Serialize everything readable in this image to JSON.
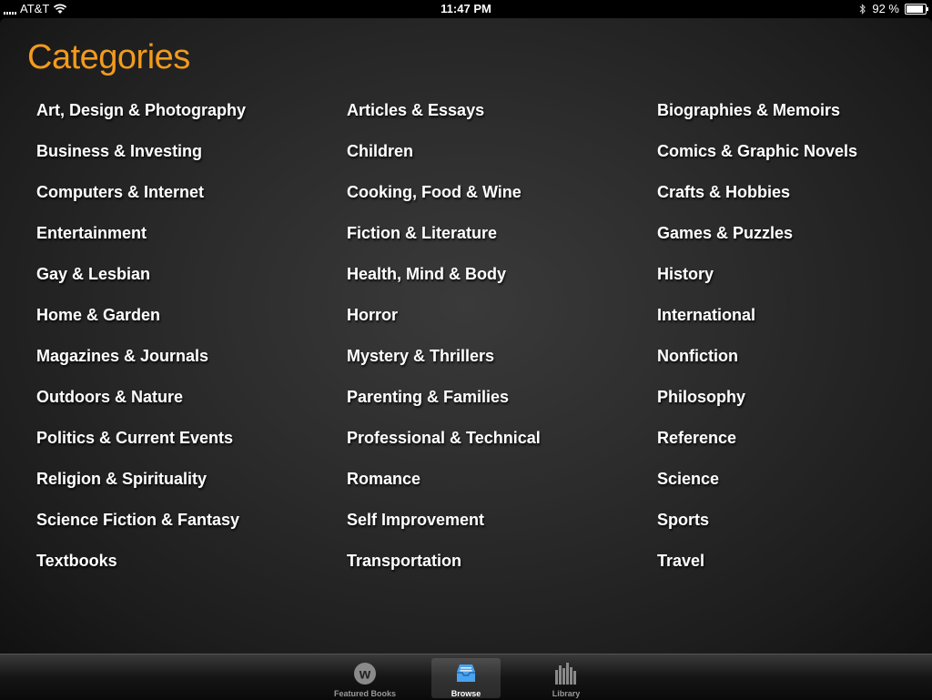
{
  "status": {
    "carrier": "AT&T",
    "time": "11:47 PM",
    "battery_text": "92 %",
    "battery_level": 0.92
  },
  "page": {
    "title": "Categories"
  },
  "categories": [
    "Art, Design & Photography",
    "Articles & Essays",
    "Biographies & Memoirs",
    "Business & Investing",
    "Children",
    "Comics & Graphic Novels",
    "Computers & Internet",
    "Cooking, Food & Wine",
    "Crafts & Hobbies",
    "Entertainment",
    "Fiction & Literature",
    "Games & Puzzles",
    "Gay & Lesbian",
    "Health, Mind & Body",
    "History",
    "Home & Garden",
    "Horror",
    "International",
    "Magazines & Journals",
    "Mystery & Thrillers",
    "Nonfiction",
    "Outdoors & Nature",
    "Parenting & Families",
    "Philosophy",
    "Politics & Current Events",
    "Professional & Technical",
    "Reference",
    "Religion & Spirituality",
    "Romance",
    "Science",
    "Science Fiction & Fantasy",
    "Self Improvement",
    "Sports",
    "Textbooks",
    "Transportation",
    "Travel"
  ],
  "tabs": [
    {
      "label": "Featured Books",
      "icon": "featured-w-icon",
      "active": false
    },
    {
      "label": "Browse",
      "icon": "browse-tray-icon",
      "active": true
    },
    {
      "label": "Library",
      "icon": "library-books-icon",
      "active": false
    }
  ],
  "colors": {
    "title": "#f39a1e",
    "category_text": "#ffffff",
    "browse_icon": "#4aa3f0"
  }
}
